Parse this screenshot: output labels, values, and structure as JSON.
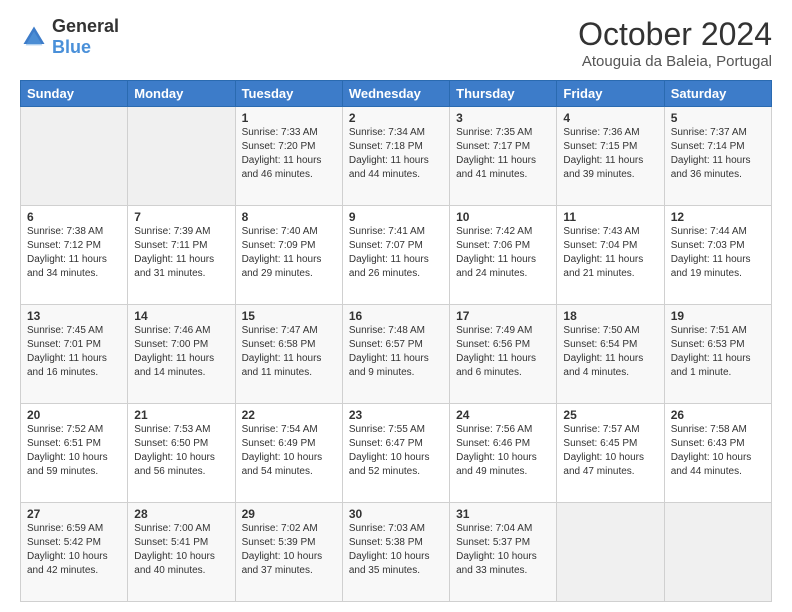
{
  "header": {
    "logo_general": "General",
    "logo_blue": "Blue",
    "month": "October 2024",
    "location": "Atouguia da Baleia, Portugal"
  },
  "columns": [
    "Sunday",
    "Monday",
    "Tuesday",
    "Wednesday",
    "Thursday",
    "Friday",
    "Saturday"
  ],
  "weeks": [
    [
      {
        "num": "",
        "info": ""
      },
      {
        "num": "",
        "info": ""
      },
      {
        "num": "1",
        "info": "Sunrise: 7:33 AM\nSunset: 7:20 PM\nDaylight: 11 hours and 46 minutes."
      },
      {
        "num": "2",
        "info": "Sunrise: 7:34 AM\nSunset: 7:18 PM\nDaylight: 11 hours and 44 minutes."
      },
      {
        "num": "3",
        "info": "Sunrise: 7:35 AM\nSunset: 7:17 PM\nDaylight: 11 hours and 41 minutes."
      },
      {
        "num": "4",
        "info": "Sunrise: 7:36 AM\nSunset: 7:15 PM\nDaylight: 11 hours and 39 minutes."
      },
      {
        "num": "5",
        "info": "Sunrise: 7:37 AM\nSunset: 7:14 PM\nDaylight: 11 hours and 36 minutes."
      }
    ],
    [
      {
        "num": "6",
        "info": "Sunrise: 7:38 AM\nSunset: 7:12 PM\nDaylight: 11 hours and 34 minutes."
      },
      {
        "num": "7",
        "info": "Sunrise: 7:39 AM\nSunset: 7:11 PM\nDaylight: 11 hours and 31 minutes."
      },
      {
        "num": "8",
        "info": "Sunrise: 7:40 AM\nSunset: 7:09 PM\nDaylight: 11 hours and 29 minutes."
      },
      {
        "num": "9",
        "info": "Sunrise: 7:41 AM\nSunset: 7:07 PM\nDaylight: 11 hours and 26 minutes."
      },
      {
        "num": "10",
        "info": "Sunrise: 7:42 AM\nSunset: 7:06 PM\nDaylight: 11 hours and 24 minutes."
      },
      {
        "num": "11",
        "info": "Sunrise: 7:43 AM\nSunset: 7:04 PM\nDaylight: 11 hours and 21 minutes."
      },
      {
        "num": "12",
        "info": "Sunrise: 7:44 AM\nSunset: 7:03 PM\nDaylight: 11 hours and 19 minutes."
      }
    ],
    [
      {
        "num": "13",
        "info": "Sunrise: 7:45 AM\nSunset: 7:01 PM\nDaylight: 11 hours and 16 minutes."
      },
      {
        "num": "14",
        "info": "Sunrise: 7:46 AM\nSunset: 7:00 PM\nDaylight: 11 hours and 14 minutes."
      },
      {
        "num": "15",
        "info": "Sunrise: 7:47 AM\nSunset: 6:58 PM\nDaylight: 11 hours and 11 minutes."
      },
      {
        "num": "16",
        "info": "Sunrise: 7:48 AM\nSunset: 6:57 PM\nDaylight: 11 hours and 9 minutes."
      },
      {
        "num": "17",
        "info": "Sunrise: 7:49 AM\nSunset: 6:56 PM\nDaylight: 11 hours and 6 minutes."
      },
      {
        "num": "18",
        "info": "Sunrise: 7:50 AM\nSunset: 6:54 PM\nDaylight: 11 hours and 4 minutes."
      },
      {
        "num": "19",
        "info": "Sunrise: 7:51 AM\nSunset: 6:53 PM\nDaylight: 11 hours and 1 minute."
      }
    ],
    [
      {
        "num": "20",
        "info": "Sunrise: 7:52 AM\nSunset: 6:51 PM\nDaylight: 10 hours and 59 minutes."
      },
      {
        "num": "21",
        "info": "Sunrise: 7:53 AM\nSunset: 6:50 PM\nDaylight: 10 hours and 56 minutes."
      },
      {
        "num": "22",
        "info": "Sunrise: 7:54 AM\nSunset: 6:49 PM\nDaylight: 10 hours and 54 minutes."
      },
      {
        "num": "23",
        "info": "Sunrise: 7:55 AM\nSunset: 6:47 PM\nDaylight: 10 hours and 52 minutes."
      },
      {
        "num": "24",
        "info": "Sunrise: 7:56 AM\nSunset: 6:46 PM\nDaylight: 10 hours and 49 minutes."
      },
      {
        "num": "25",
        "info": "Sunrise: 7:57 AM\nSunset: 6:45 PM\nDaylight: 10 hours and 47 minutes."
      },
      {
        "num": "26",
        "info": "Sunrise: 7:58 AM\nSunset: 6:43 PM\nDaylight: 10 hours and 44 minutes."
      }
    ],
    [
      {
        "num": "27",
        "info": "Sunrise: 6:59 AM\nSunset: 5:42 PM\nDaylight: 10 hours and 42 minutes."
      },
      {
        "num": "28",
        "info": "Sunrise: 7:00 AM\nSunset: 5:41 PM\nDaylight: 10 hours and 40 minutes."
      },
      {
        "num": "29",
        "info": "Sunrise: 7:02 AM\nSunset: 5:39 PM\nDaylight: 10 hours and 37 minutes."
      },
      {
        "num": "30",
        "info": "Sunrise: 7:03 AM\nSunset: 5:38 PM\nDaylight: 10 hours and 35 minutes."
      },
      {
        "num": "31",
        "info": "Sunrise: 7:04 AM\nSunset: 5:37 PM\nDaylight: 10 hours and 33 minutes."
      },
      {
        "num": "",
        "info": ""
      },
      {
        "num": "",
        "info": ""
      }
    ]
  ]
}
